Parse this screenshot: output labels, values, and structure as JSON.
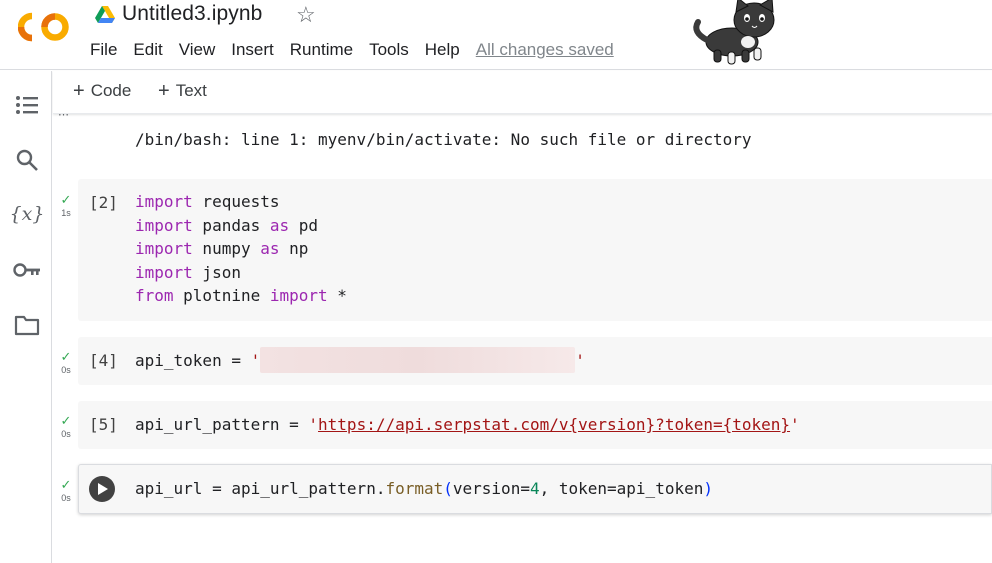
{
  "header": {
    "title": "Untitled3.ipynb",
    "menu": [
      "File",
      "Edit",
      "View",
      "Insert",
      "Runtime",
      "Tools",
      "Help"
    ],
    "save_status": "All changes saved",
    "logo": "colab-logo",
    "drive_icon": "google-drive-icon",
    "star_icon": "star-outline-icon",
    "avatar": "cat-sticker"
  },
  "sidebar": {
    "icons": [
      "table-of-contents-icon",
      "search-icon",
      "variables-icon",
      "secrets-key-icon",
      "files-folder-icon"
    ],
    "variables_glyph": "{x}"
  },
  "toolbar": {
    "add_code": "Code",
    "add_text": "Text",
    "plus": "+"
  },
  "output": {
    "text": "/bin/bash: line 1: myenv/bin/activate: No such file or directory"
  },
  "cells": [
    {
      "exec_count": "[2]",
      "status_time": "1s",
      "lines": [
        {
          "kw": "import",
          "rest": " requests"
        },
        {
          "kw": "import",
          "rest": " pandas ",
          "kw2": "as",
          "rest2": " pd"
        },
        {
          "kw": "import",
          "rest": " numpy ",
          "kw2": "as",
          "rest2": " np"
        },
        {
          "kw": "import",
          "rest": " json"
        },
        {
          "kw": "from",
          "rest": " plotnine ",
          "kw2": "import",
          "rest2": " *"
        }
      ]
    },
    {
      "exec_count": "[4]",
      "status_time": "0s",
      "code_prefix": "api_token = ",
      "quote_open": "'",
      "quote_close": "'"
    },
    {
      "exec_count": "[5]",
      "status_time": "0s",
      "code_prefix": "api_url_pattern = ",
      "quote_open": "'",
      "url": "https://api.serpstat.com/v{version}?token={token}",
      "quote_close": "'"
    },
    {
      "status_time": "0s",
      "code_prefix": "api_url = api_url_pattern.",
      "method": "format",
      "paren_open": "(",
      "arg1": "version=",
      "arg1_val": "4",
      "arg2": ", token=api_token",
      "paren_close": ")"
    }
  ],
  "check_glyph": "✓",
  "colors": {
    "keyword": "#9c27b0",
    "string": "#a31515",
    "check": "#34a853",
    "cell_bg": "#f7f7f7"
  }
}
